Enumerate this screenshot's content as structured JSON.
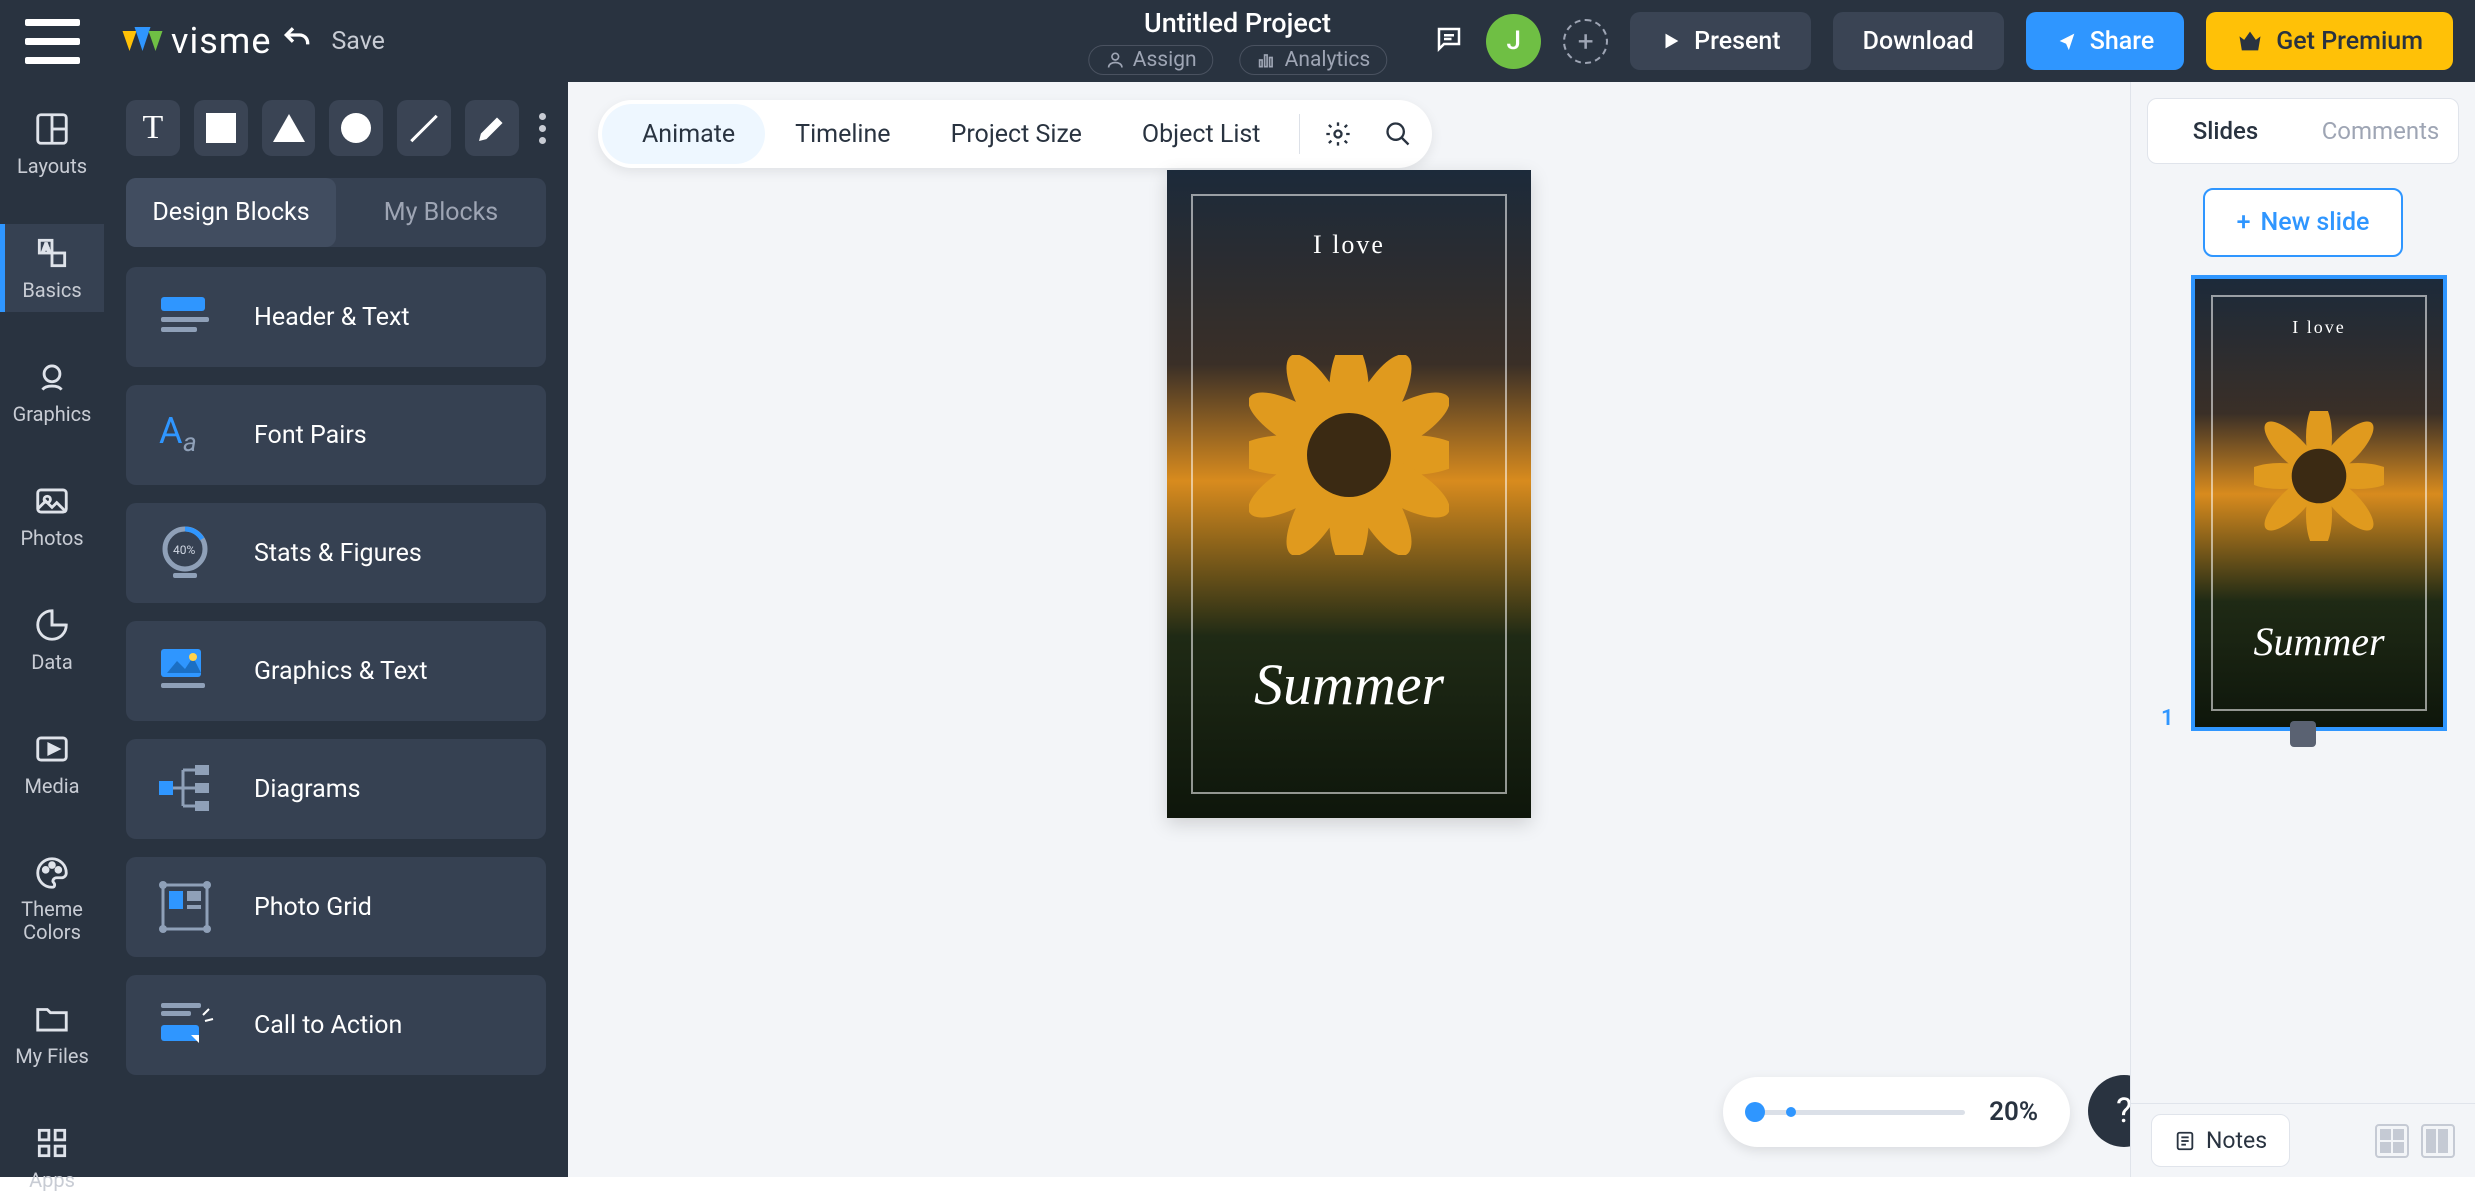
{
  "header": {
    "save": "Save",
    "title": "Untitled Project",
    "assign": "Assign",
    "analytics": "Analytics",
    "avatar_initial": "J",
    "present": "Present",
    "download": "Download",
    "share": "Share",
    "premium": "Get Premium",
    "logo_text": "visme"
  },
  "rail": {
    "items": [
      {
        "label": "Layouts"
      },
      {
        "label": "Basics"
      },
      {
        "label": "Graphics"
      },
      {
        "label": "Photos"
      },
      {
        "label": "Data"
      },
      {
        "label": "Media"
      },
      {
        "label": "Theme Colors"
      },
      {
        "label": "My Files"
      },
      {
        "label": "Apps"
      }
    ]
  },
  "sidebar": {
    "tabs": {
      "design": "Design Blocks",
      "my": "My Blocks"
    },
    "blocks": [
      {
        "label": "Header & Text"
      },
      {
        "label": "Font Pairs"
      },
      {
        "label": "Stats & Figures",
        "badge": "40%"
      },
      {
        "label": "Graphics & Text"
      },
      {
        "label": "Diagrams"
      },
      {
        "label": "Photo Grid"
      },
      {
        "label": "Call to Action"
      }
    ]
  },
  "canvas_toolbar": {
    "animate": "Animate",
    "timeline": "Timeline",
    "project_size": "Project Size",
    "object_list": "Object List"
  },
  "slide": {
    "line1": "I love",
    "line2": "Summer"
  },
  "zoom": {
    "value": "20%"
  },
  "help": "?",
  "right": {
    "tabs": {
      "slides": "Slides",
      "comments": "Comments"
    },
    "new_slide": "New slide",
    "thumb_number": "1",
    "notes": "Notes"
  }
}
